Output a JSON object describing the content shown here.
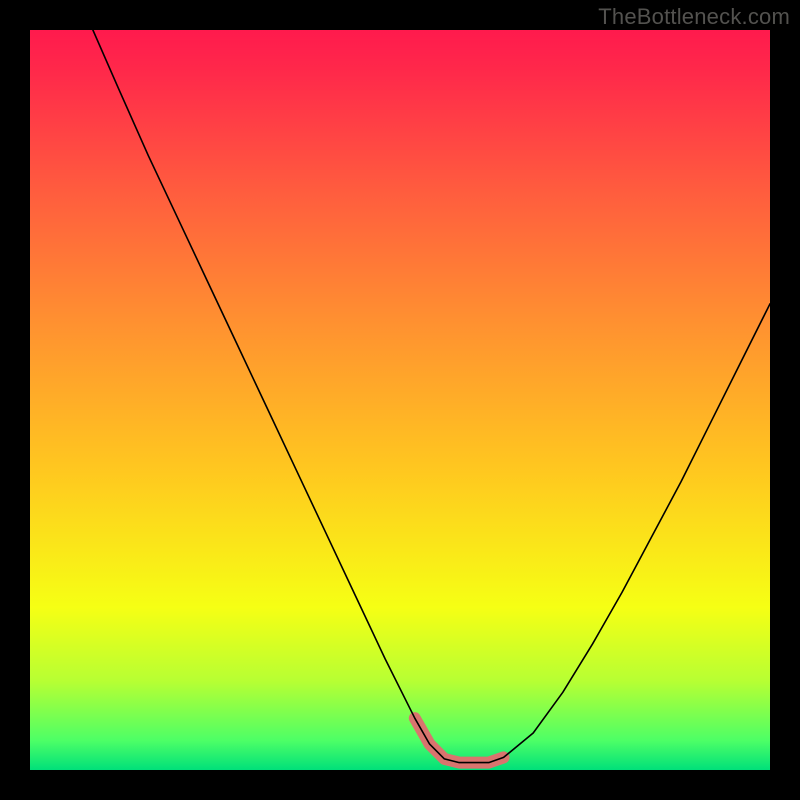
{
  "attribution": "TheBottleneck.com",
  "gradient_stops": [
    {
      "offset": 0.0,
      "color": "#ff1a4d"
    },
    {
      "offset": 0.06,
      "color": "#ff2a4a"
    },
    {
      "offset": 0.22,
      "color": "#ff5d3e"
    },
    {
      "offset": 0.4,
      "color": "#ff9230"
    },
    {
      "offset": 0.6,
      "color": "#ffc91f"
    },
    {
      "offset": 0.78,
      "color": "#f6ff14"
    },
    {
      "offset": 0.88,
      "color": "#b7ff33"
    },
    {
      "offset": 0.96,
      "color": "#4dff66"
    },
    {
      "offset": 1.0,
      "color": "#00e07a"
    }
  ],
  "curve_stroke": "#000000",
  "curve_stroke_width": 1.6,
  "highlight_stroke": "#d9746e",
  "highlight_stroke_width": 12,
  "chart_data": {
    "type": "line",
    "title": "",
    "xlabel": "",
    "ylabel": "",
    "xlim": [
      0,
      100
    ],
    "ylim": [
      0,
      100
    ],
    "series": [
      {
        "name": "curve",
        "x": [
          8.5,
          12,
          16,
          20,
          24,
          28,
          32,
          36,
          40,
          44,
          48,
          52,
          54,
          56,
          58,
          60,
          62,
          64,
          68,
          72,
          76,
          80,
          84,
          88,
          92,
          96,
          100
        ],
        "y": [
          100,
          92,
          83,
          74.5,
          66,
          57.5,
          49,
          40.5,
          32,
          23.5,
          15,
          7,
          3.5,
          1.5,
          1,
          1,
          1,
          1.7,
          5,
          10.5,
          17,
          24,
          31.5,
          39,
          47,
          55,
          63
        ]
      },
      {
        "name": "highlight-flat-bottom",
        "x": [
          52,
          54,
          56,
          58,
          60,
          62,
          64
        ],
        "y": [
          7,
          3.5,
          1.5,
          1,
          1,
          1,
          1.7
        ]
      }
    ]
  }
}
